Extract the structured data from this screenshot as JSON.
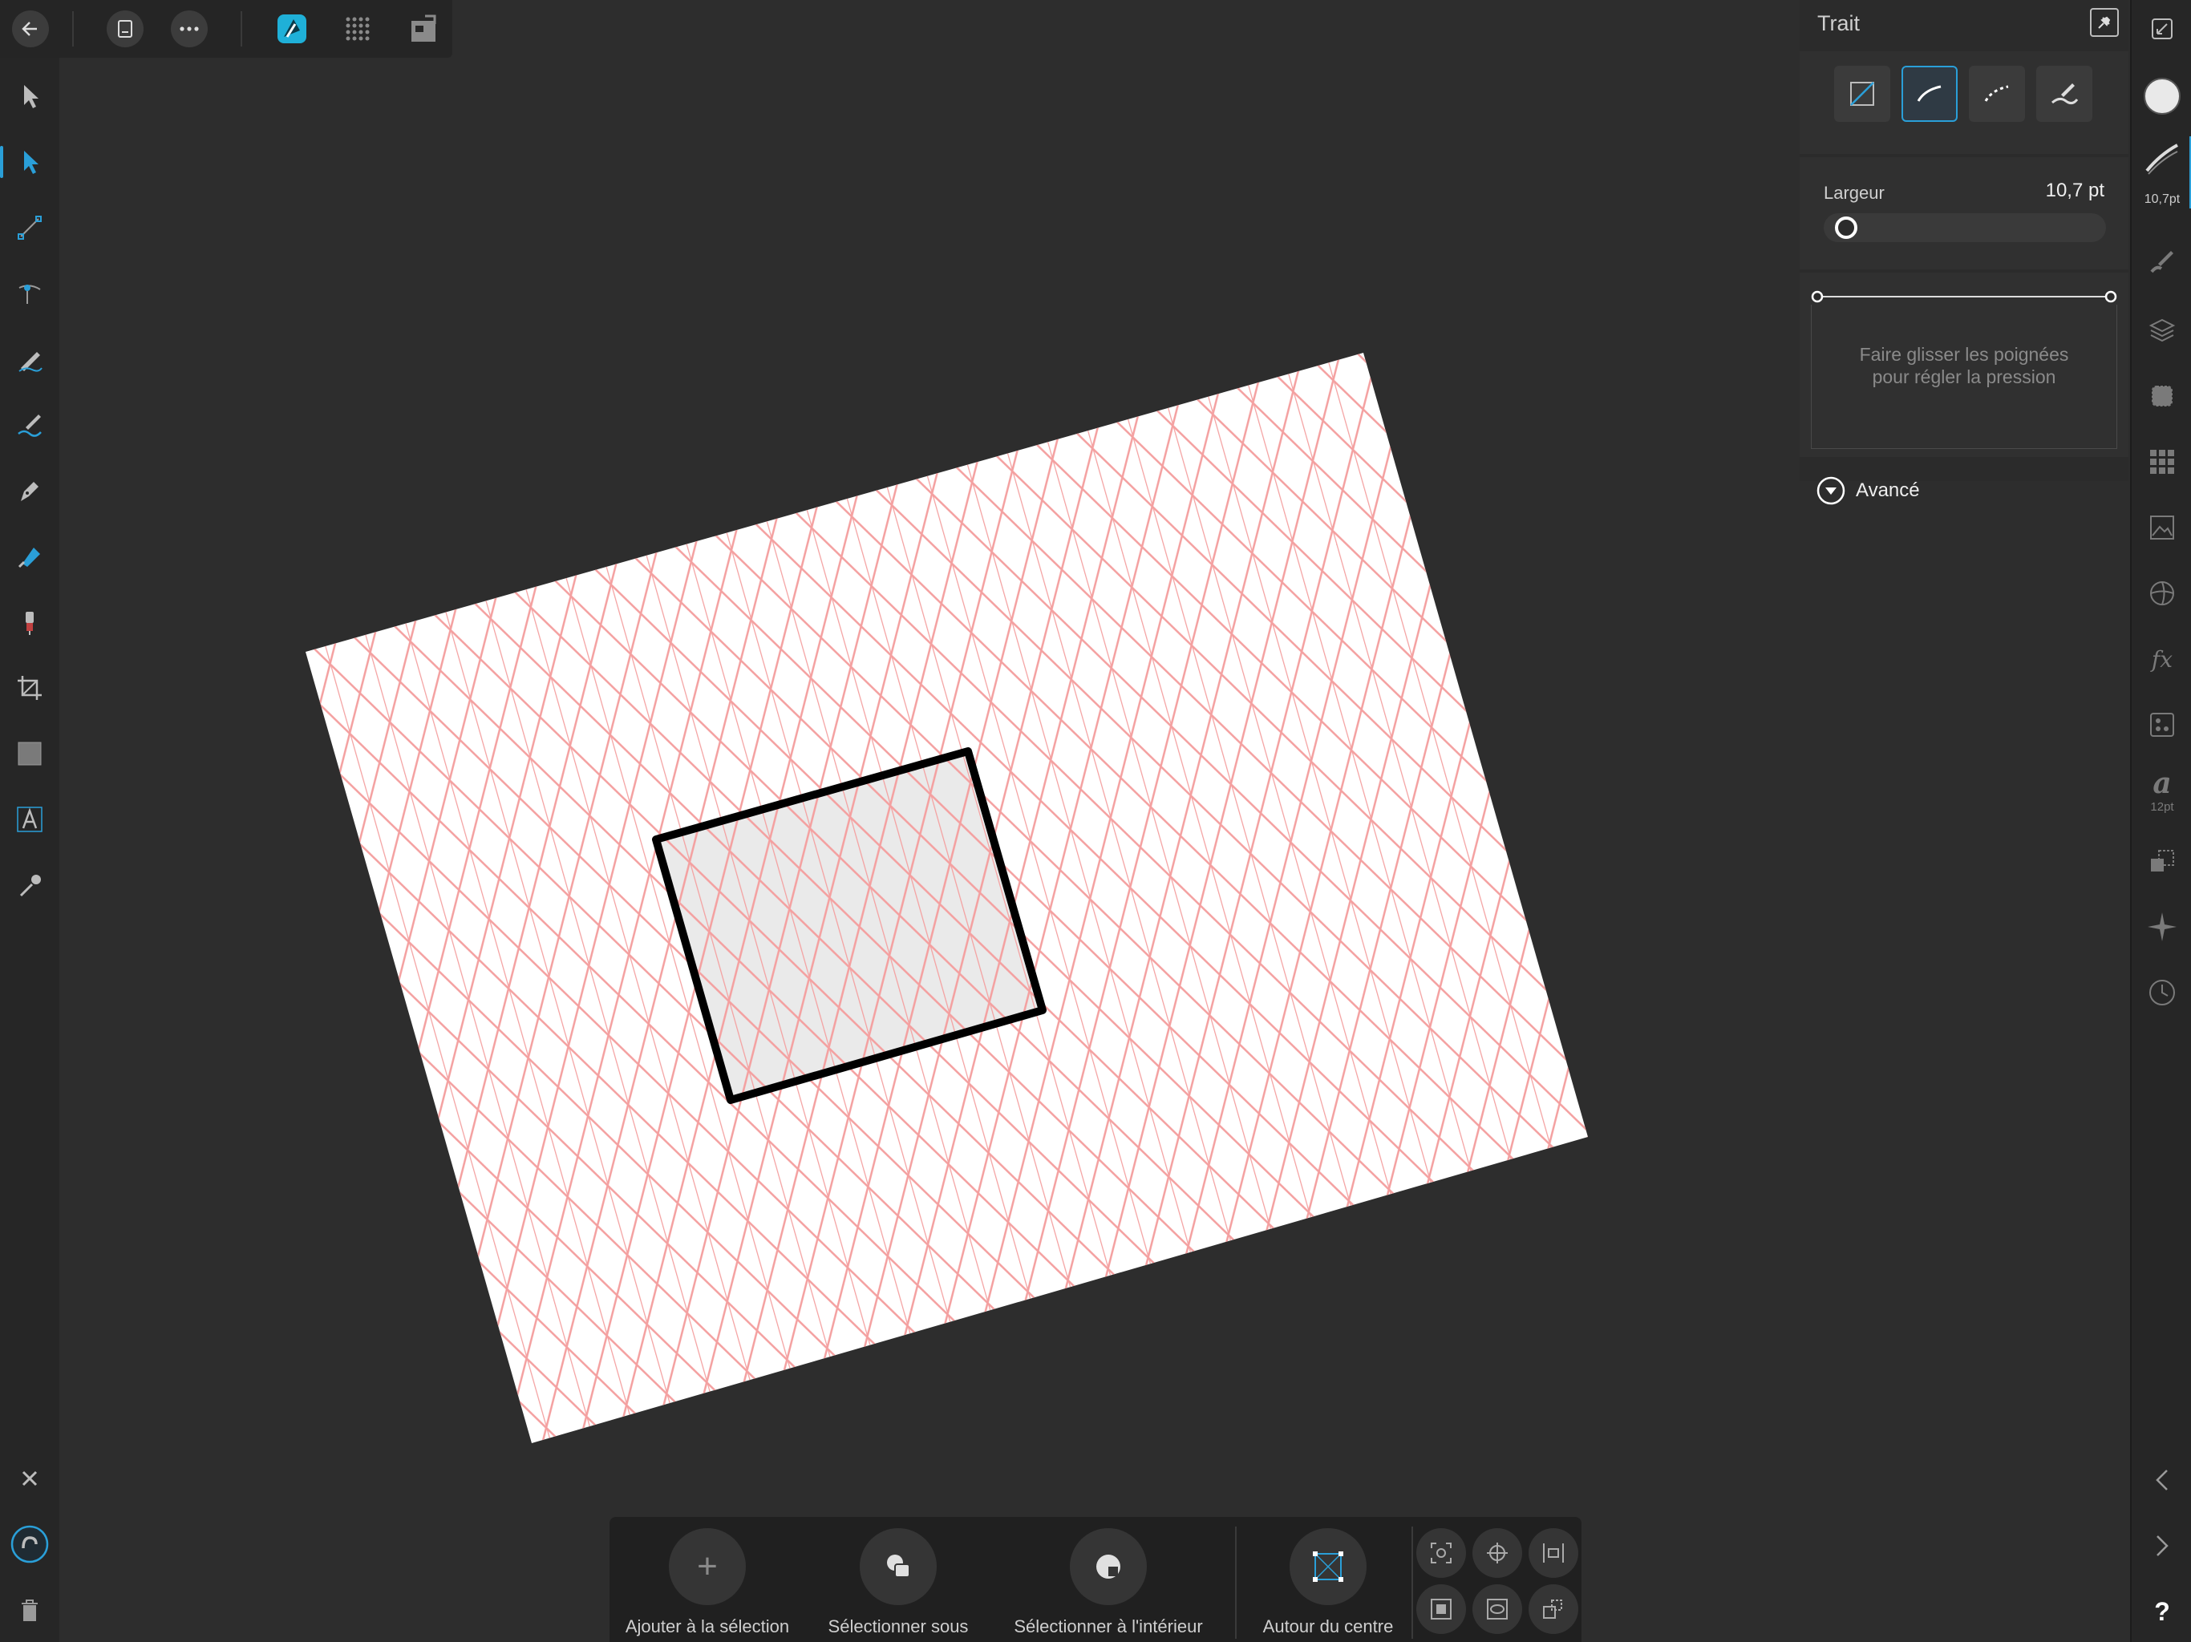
{
  "app": {
    "toolbar": {
      "icons": [
        "back-arrow-icon",
        "document-icon",
        "more-icon",
        "persona-designer-icon",
        "persona-pixel-icon",
        "persona-export-icon"
      ]
    }
  },
  "left_tools": [
    "move-tool-icon",
    "node-tool-icon",
    "corner-tool-icon",
    "point-transform-icon",
    "pencil-tool-icon",
    "vector-brush-icon",
    "pen-tool-icon",
    "fill-tool-icon",
    "transparency-tool-icon",
    "crop-tool-icon",
    "rectangle-tool-icon",
    "text-tool-icon",
    "color-picker-icon"
  ],
  "left_bottom": [
    "close-icon",
    "snapping-magnet-icon",
    "trash-icon"
  ],
  "stroke_panel": {
    "title": "Trait",
    "style_buttons": [
      "no-stroke-icon",
      "solid-line-icon",
      "dashed-line-icon",
      "brush-stroke-icon"
    ],
    "selected_style": 1,
    "width_label": "Largeur",
    "width_value": "10,7 pt",
    "width_fraction": 0.05,
    "pressure_hint_line1": "Faire glisser les poignées",
    "pressure_hint_line2": "pour régler la pression",
    "advanced_label": "Avancé"
  },
  "right_strip": {
    "stroke_value": "10,7pt",
    "text_size": "12pt",
    "text_glyph": "a",
    "help_glyph": "?",
    "icons": [
      "expand-icon",
      "fill-color-swatch",
      "stroke-icon",
      "brush-icon",
      "layers-icon",
      "effects-icon",
      "swatches-icon",
      "image-icon",
      "color-wheel-icon",
      "fx-icon",
      "adjustments-icon",
      "text-style-icon",
      "transform-icon",
      "navigator-icon",
      "history-icon",
      "collapse-left-icon",
      "expand-right-icon",
      "help-icon"
    ]
  },
  "context_bar": {
    "add_label": "Ajouter à la sélection",
    "add_glyph": "+",
    "select_under_label": "Sélectionner sous",
    "select_inside_label": "Sélectionner à l'intérieur",
    "around_center_label": "Autour du centre"
  },
  "colors": {
    "accent": "#2a9fd8",
    "grid_line": "#f4a0a0",
    "canvas_bg": "#2d2d2d",
    "shape_fill": "#e8e8e8",
    "shape_stroke": "#000000"
  }
}
